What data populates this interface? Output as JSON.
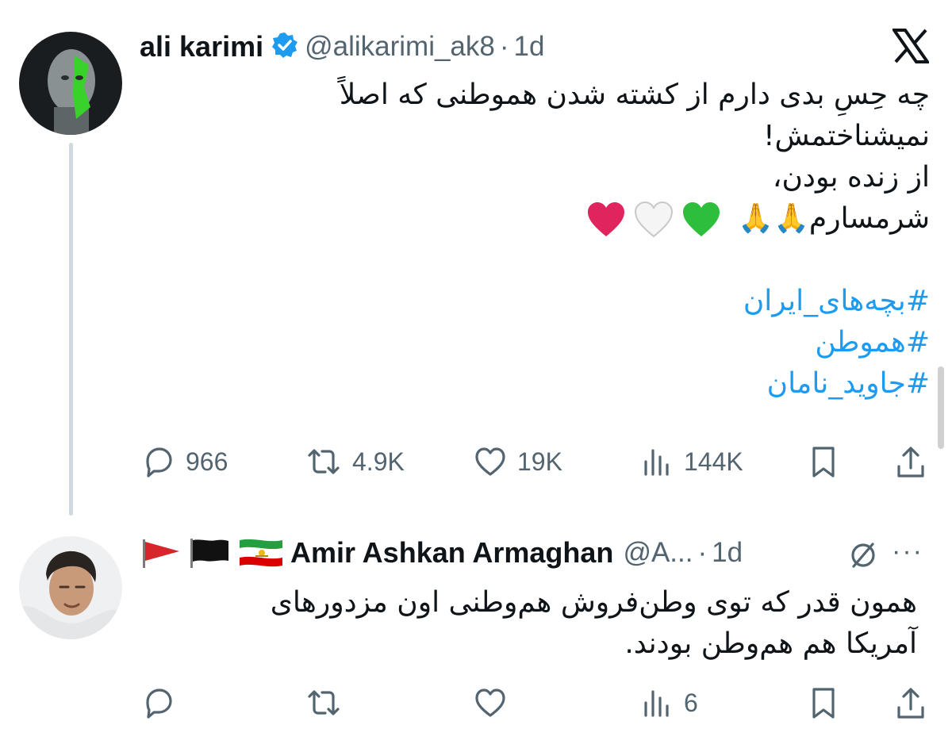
{
  "x_icon": "x-logo-icon",
  "tweet1": {
    "name": "ali karimi",
    "handle": "@alikarimi_ak8",
    "separator": "·",
    "time": "1d",
    "lines": [
      "چه حِسِ بدی دارم از کشته شدن  هموطنی که اصلاً",
      "نمیشناختمش!",
      "از زنده بودن،",
      "شرمسارم🙏🙏"
    ],
    "hearts": [
      "#e0245e",
      "#ffffff",
      "#2dbf3c"
    ],
    "hashtags": [
      "#بچه‌های_ایران",
      "#هموطن",
      "#جاوید_نامان"
    ],
    "stats": {
      "replies": "966",
      "retweets": "4.9K",
      "likes": "19K",
      "views": "144K"
    }
  },
  "tweet2": {
    "name": "Amir Ashkan Armaghan",
    "handle": "@A...",
    "separator": "·",
    "time": "1d",
    "more": "···",
    "lines": [
      "همون قدر که توی وطن‌فروش هم‌وطنی اون مزدورهای",
      "آمریکا هم هم‌وطن بودند."
    ],
    "stats": {
      "views": "6"
    }
  },
  "colors": {
    "accent": "#1d9bf0",
    "text": "#0f1419",
    "muted": "#536471"
  }
}
